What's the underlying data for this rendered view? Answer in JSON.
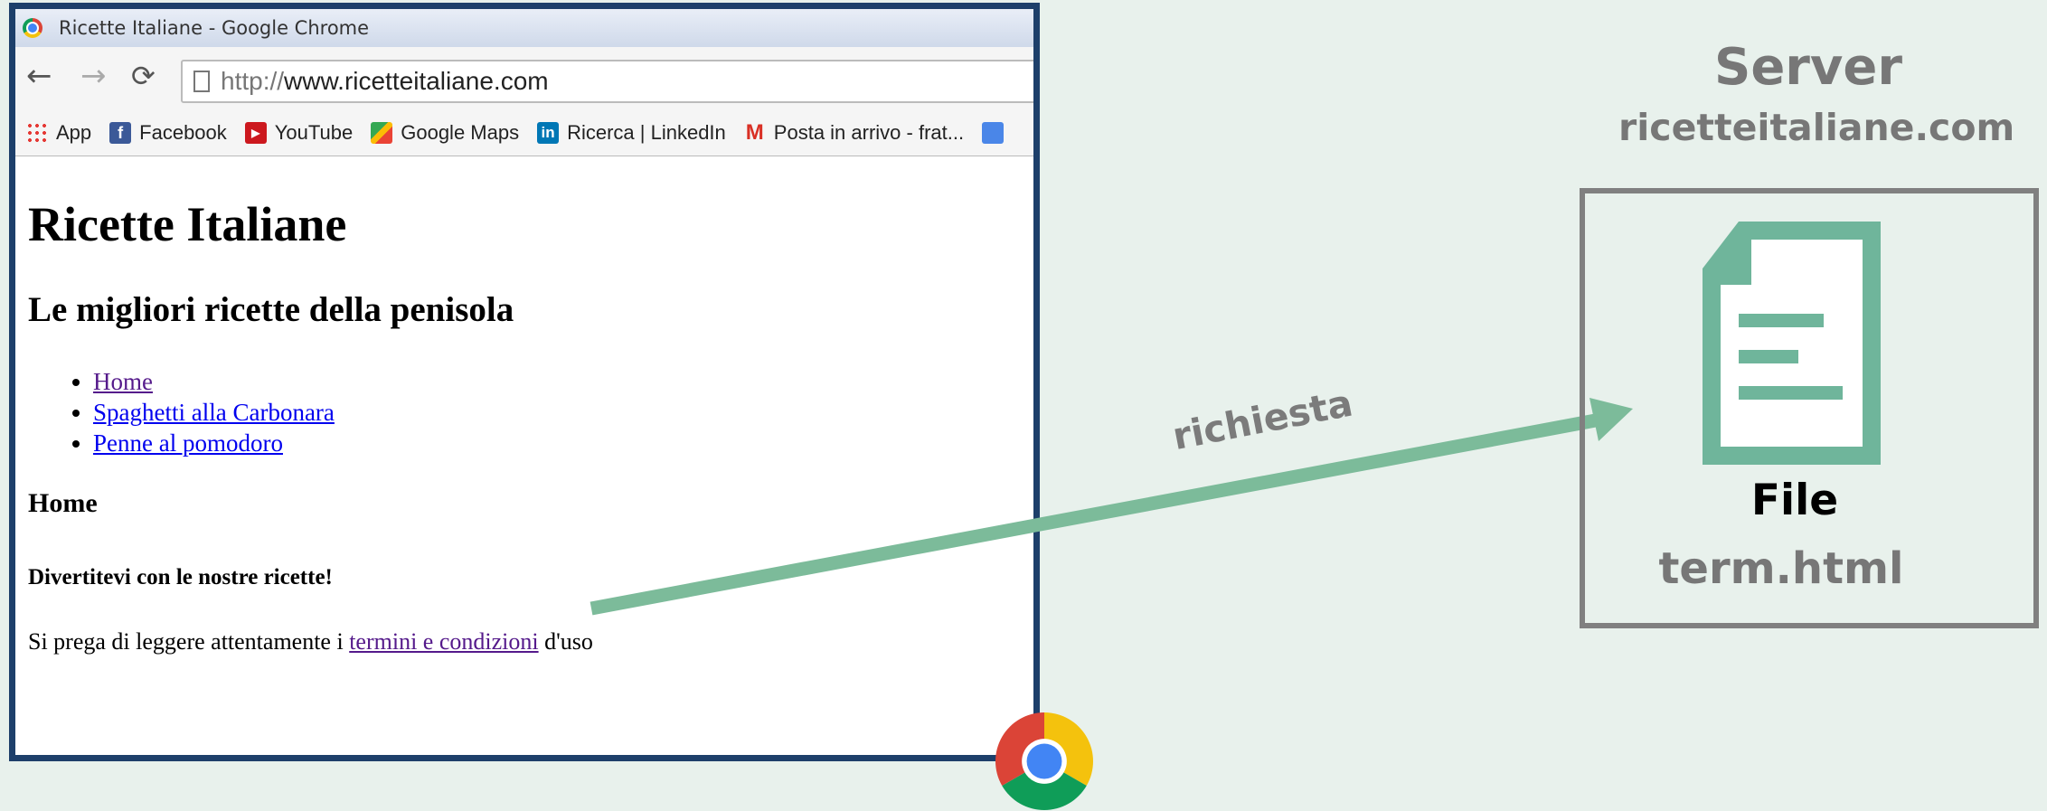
{
  "browser": {
    "window_title": "Ricette Italiane - Google Chrome",
    "url_prefix": "http://",
    "url_host": "www.ricetteitaliane.com",
    "bookmarks": [
      {
        "label": "App",
        "icon": "apps-icon"
      },
      {
        "label": "Facebook",
        "icon": "facebook-icon"
      },
      {
        "label": "YouTube",
        "icon": "youtube-icon"
      },
      {
        "label": "Google Maps",
        "icon": "google-maps-icon"
      },
      {
        "label": "Ricerca | LinkedIn",
        "icon": "linkedin-icon"
      },
      {
        "label": "Posta in arrivo - frat...",
        "icon": "gmail-icon"
      }
    ]
  },
  "page": {
    "title": "Ricette Italiane",
    "subtitle": "Le migliori ricette della penisola",
    "nav": [
      "Home",
      "Spaghetti alla Carbonara",
      "Penne al pomodoro"
    ],
    "section": "Home",
    "tagline": "Divertitevi con le nostre ricette!",
    "para_before": "Si prega di leggere attentamente i ",
    "para_link": "termini e condizioni",
    "para_after": " d'uso"
  },
  "diagram": {
    "arrow_label": "richiesta",
    "arrow_color": "#7cbb9a",
    "server_title": "Server",
    "server_host": "ricetteitaliane.com",
    "file_label": "File",
    "file_name": "term.html",
    "file_icon_color": "#6fb59b"
  }
}
